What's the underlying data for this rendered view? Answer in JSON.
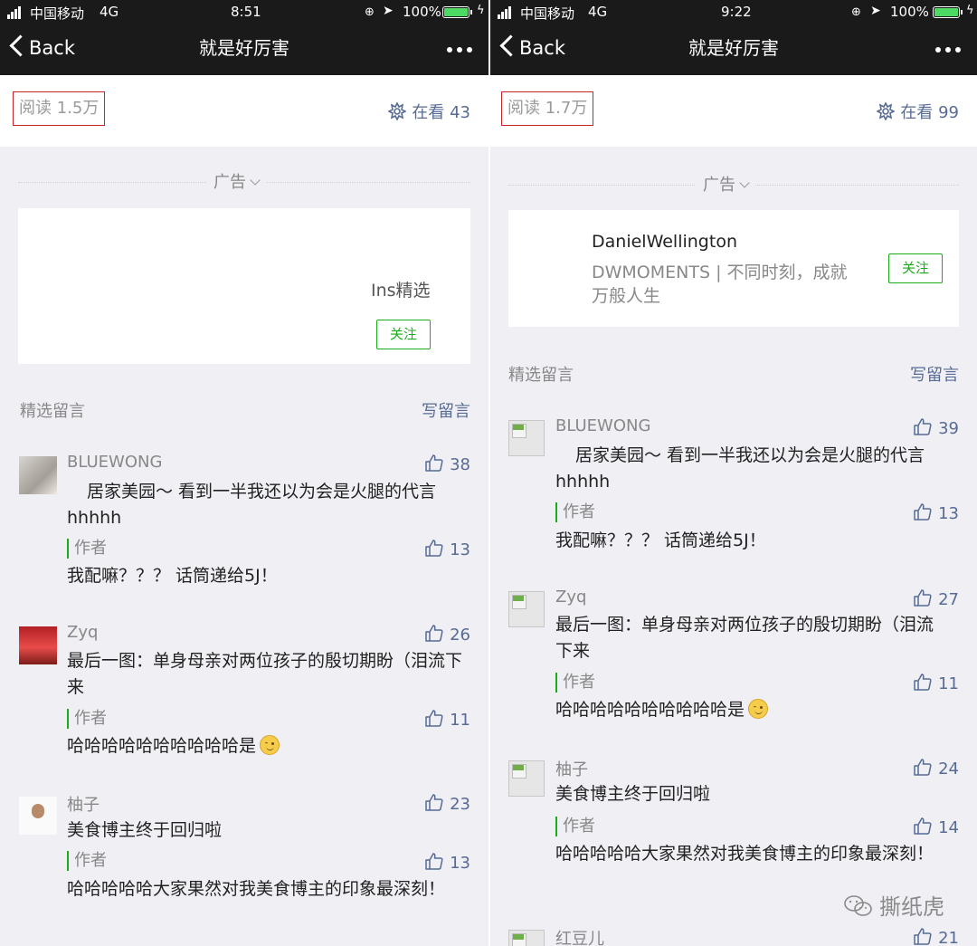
{
  "colors": {
    "link": "#576b95",
    "accent_green": "#1aad19",
    "highlight_red": "#c8222a",
    "nav_bg": "#1a1a1a"
  },
  "left": {
    "status": {
      "carrier": "中国移动",
      "network": "4G",
      "time": "8:51",
      "battery": "100%"
    },
    "nav": {
      "back_label": "Back",
      "title": "就是好厉害"
    },
    "stats": {
      "read": "阅读 1.5万",
      "looking_label": "在看",
      "looking_count": "43"
    },
    "ad": {
      "label": "广告",
      "card_text": "Ins精选",
      "follow_label": "关注"
    },
    "comments_header": {
      "title": "精选留言",
      "write_label": "写留言"
    },
    "comments": [
      {
        "name": "BLUEWONG",
        "likes": "38",
        "text": "居家美园～ 看到一半我还以为会是火腿的代言hhhhh",
        "author_label": "作者",
        "author_likes": "13",
        "reply": "我配嘛？？？ 话筒递给5J！"
      },
      {
        "name": "Zyq",
        "likes": "26",
        "text": "最后一图：单身母亲对两位孩子的殷切期盼（泪流下来",
        "author_label": "作者",
        "author_likes": "11",
        "reply": "哈哈哈哈哈哈哈哈哈哈是"
      },
      {
        "name": "柚子",
        "likes": "23",
        "text": "美食博主终于回归啦",
        "author_label": "作者",
        "author_likes": "13",
        "reply": "哈哈哈哈哈大家果然对我美食博主的印象最深刻！"
      }
    ]
  },
  "right": {
    "status": {
      "carrier": "中国移动",
      "network": "4G",
      "time": "9:22",
      "battery": "100%"
    },
    "nav": {
      "back_label": "Back",
      "title": "就是好厉害"
    },
    "stats": {
      "read": "阅读 1.7万",
      "looking_label": "在看",
      "looking_count": "99"
    },
    "ad": {
      "label": "广告",
      "brand": "DanielWellington",
      "desc": "DWMOMENTS | 不同时刻，成就万般人生",
      "follow_label": "关注"
    },
    "comments_header": {
      "title": "精选留言",
      "write_label": "写留言"
    },
    "comments": [
      {
        "name": "BLUEWONG",
        "likes": "39",
        "text": "居家美园～ 看到一半我还以为会是火腿的代言hhhhh",
        "author_label": "作者",
        "author_likes": "13",
        "reply": "我配嘛？？？ 话筒递给5J！"
      },
      {
        "name": "Zyq",
        "likes": "27",
        "text": "最后一图：单身母亲对两位孩子的殷切期盼（泪流下来",
        "author_label": "作者",
        "author_likes": "11",
        "reply": "哈哈哈哈哈哈哈哈哈哈是"
      },
      {
        "name": "柚子",
        "likes": "24",
        "text": "美食博主终于回归啦",
        "author_label": "作者",
        "author_likes": "14",
        "reply": "哈哈哈哈哈大家果然对我美食博主的印象最深刻！"
      },
      {
        "name": "红豆儿",
        "likes": "21"
      }
    ]
  },
  "watermark": "撕纸虎"
}
